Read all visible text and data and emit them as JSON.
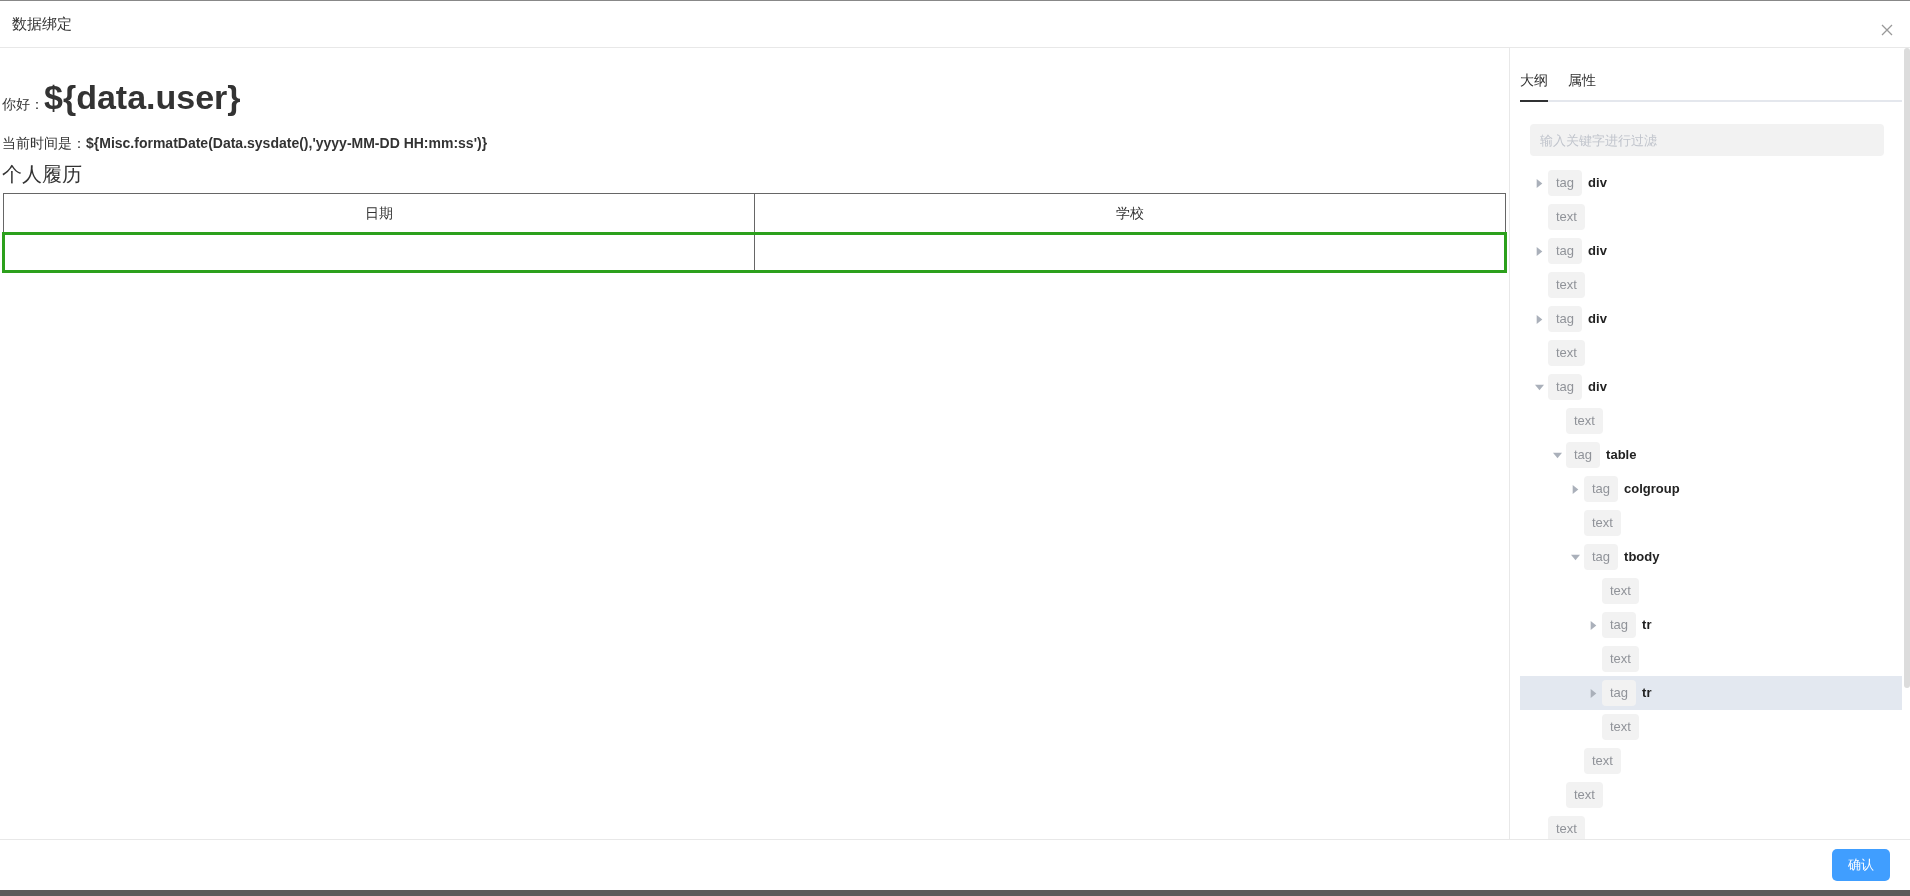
{
  "dialog": {
    "title": "数据绑定"
  },
  "document": {
    "greeting_label": "你好：",
    "greeting_value": "${data.user}",
    "time_label": "当前时间是：",
    "time_value": "${Misc.formatDate(Data.sysdate(),'yyyy-MM-DD HH:mm:ss')}",
    "section_title": "个人履历",
    "table": {
      "columns": [
        "日期",
        "学校"
      ],
      "rows": [
        {
          "selected": true
        }
      ]
    }
  },
  "side_panel": {
    "tabs": [
      {
        "label": "大纲",
        "selected": true
      },
      {
        "label": "属性",
        "selected": false
      }
    ],
    "filter": {
      "placeholder": "输入关键字进行过滤"
    },
    "tree": [
      {
        "kind": "tag",
        "label": "tag",
        "name": "div",
        "expanded": false,
        "selected": false
      },
      {
        "kind": "text",
        "label": "text",
        "selected": false
      },
      {
        "kind": "tag",
        "label": "tag",
        "name": "div",
        "expanded": false,
        "selected": false
      },
      {
        "kind": "text",
        "label": "text",
        "selected": false
      },
      {
        "kind": "tag",
        "label": "tag",
        "name": "div",
        "expanded": false,
        "selected": false
      },
      {
        "kind": "text",
        "label": "text",
        "selected": false
      },
      {
        "kind": "tag",
        "label": "tag",
        "name": "div",
        "expanded": true,
        "selected": false,
        "children": [
          {
            "kind": "text",
            "label": "text",
            "selected": false
          },
          {
            "kind": "tag",
            "label": "tag",
            "name": "table",
            "expanded": true,
            "selected": false,
            "children": [
              {
                "kind": "tag",
                "label": "tag",
                "name": "colgroup",
                "expanded": false,
                "selected": false
              },
              {
                "kind": "text",
                "label": "text",
                "selected": false
              },
              {
                "kind": "tag",
                "label": "tag",
                "name": "tbody",
                "expanded": true,
                "selected": false,
                "children": [
                  {
                    "kind": "text",
                    "label": "text",
                    "selected": false
                  },
                  {
                    "kind": "tag",
                    "label": "tag",
                    "name": "tr",
                    "expanded": false,
                    "selected": false
                  },
                  {
                    "kind": "text",
                    "label": "text",
                    "selected": false
                  },
                  {
                    "kind": "tag",
                    "label": "tag",
                    "name": "tr",
                    "expanded": false,
                    "selected": true
                  },
                  {
                    "kind": "text",
                    "label": "text",
                    "selected": false
                  }
                ]
              },
              {
                "kind": "text",
                "label": "text",
                "selected": false
              }
            ]
          },
          {
            "kind": "text",
            "label": "text",
            "selected": false
          }
        ]
      },
      {
        "kind": "text",
        "label": "text",
        "selected": false
      }
    ]
  },
  "footer": {
    "buttons": [
      {
        "label": "确认"
      }
    ]
  }
}
